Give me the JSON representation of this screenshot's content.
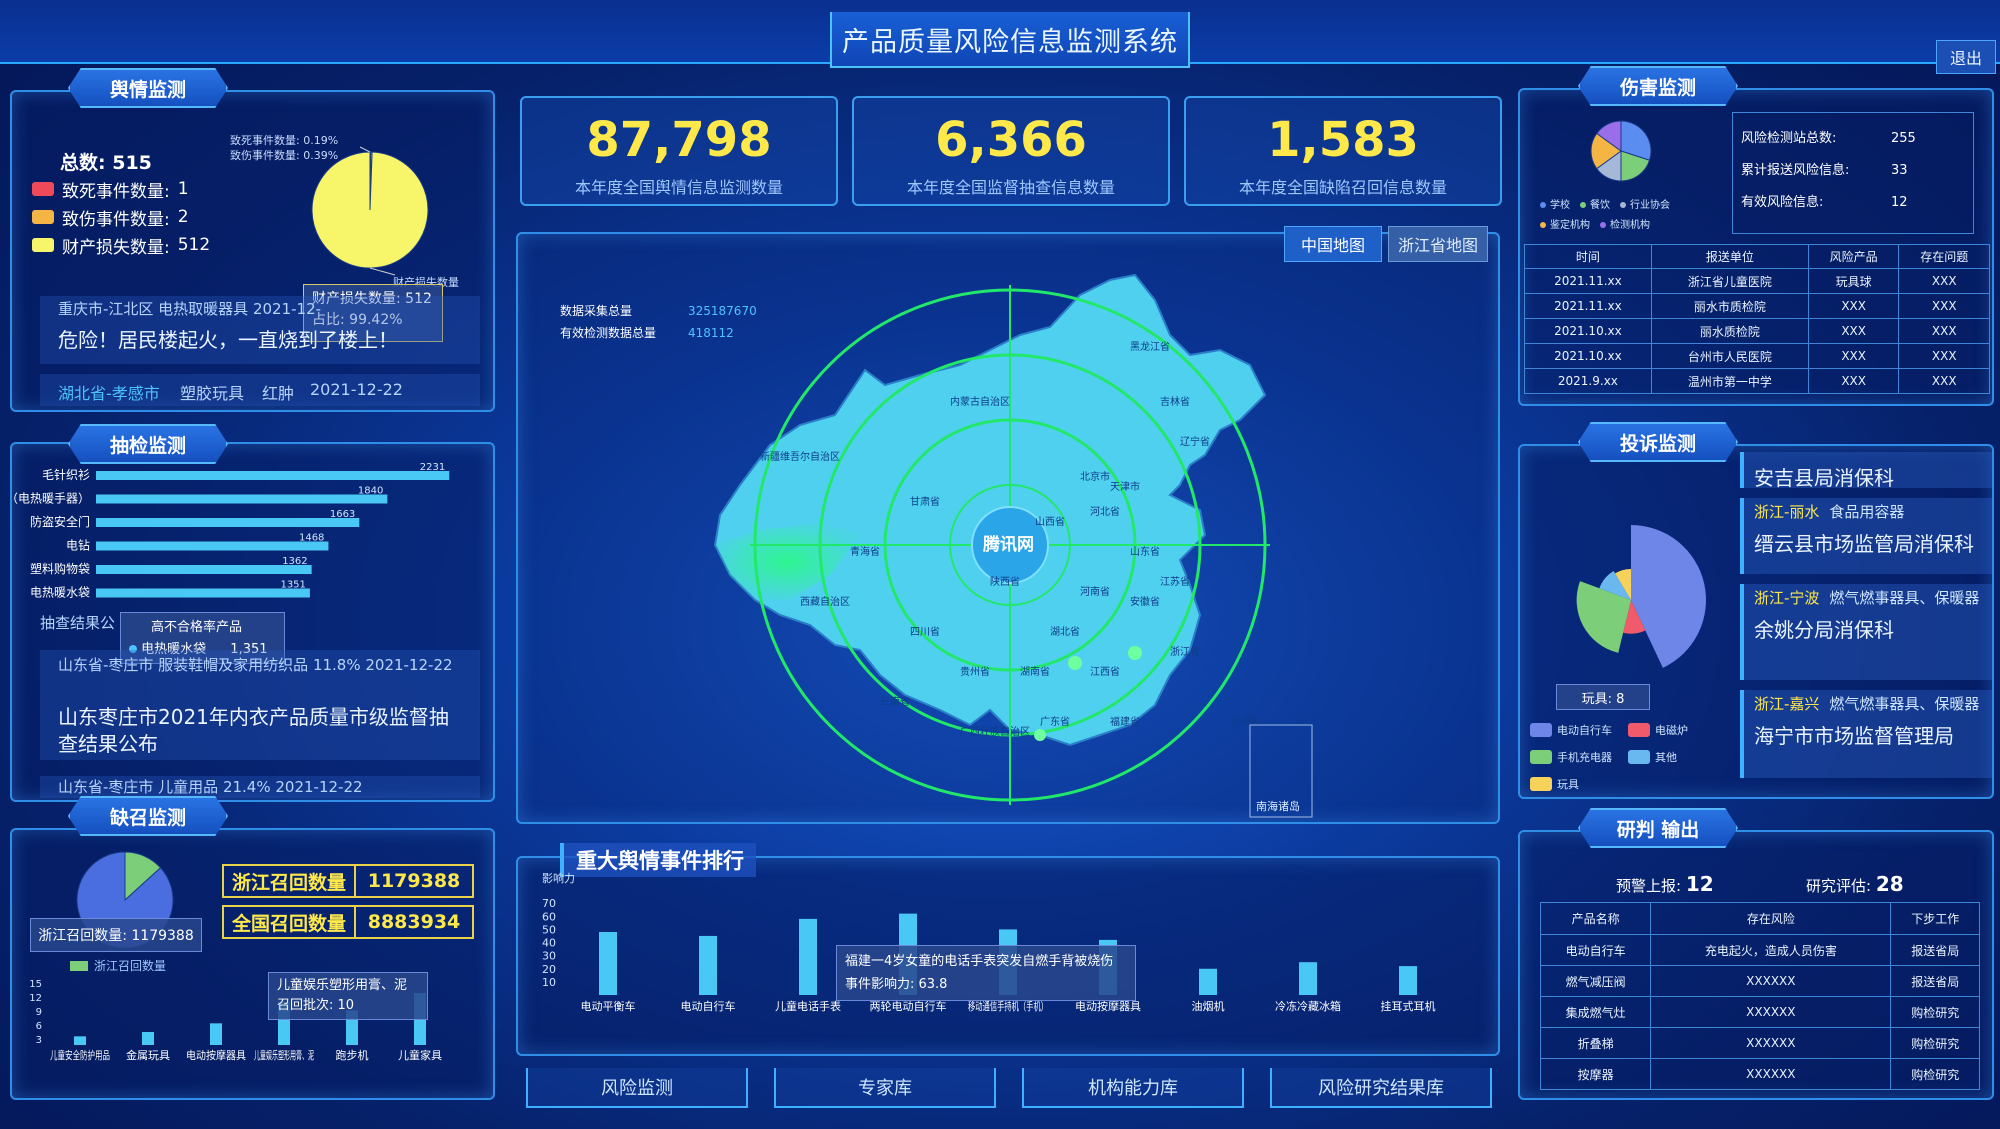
{
  "app": {
    "title": "产品质量风险信息监测系统",
    "logout": "退出"
  },
  "sentiment": {
    "panel_title": "舆情监测",
    "total_label": "总数:",
    "total": "515",
    "legend": [
      {
        "label": "致死事件数量:",
        "value": "1",
        "color": "#f04a5a"
      },
      {
        "label": "致伤事件数量:",
        "value": "2",
        "color": "#f5b545"
      },
      {
        "label": "财产损失数量:",
        "value": "512",
        "color": "#f7f56a"
      }
    ],
    "pie_labels": [
      "致死事件数量: 0.19%",
      "致伤事件数量: 0.39%",
      "财产损失数量"
    ],
    "tooltip_line1": "财产损失数量: 512",
    "tooltip_line2": "占比: 99.42%",
    "news_meta_1": "重庆市-江北区    电热取暖器具    2021-12-",
    "news_headline_1": "危险！居民楼起火，一直烧到了楼上！",
    "news_meta_2_region": "湖北省-孝感市",
    "news_meta_2_cat": "塑胶玩具",
    "news_meta_2_tag": "红肿",
    "news_meta_2_date": "2021-12-22"
  },
  "spotcheck": {
    "panel_title": "抽检监测",
    "overlay_title": "高不合格率产品",
    "overlay_item": "电热暖水袋",
    "overlay_value": "1,351",
    "section_label": "抽查结果公布",
    "news_meta": "山东省-枣庄市    服装鞋帽及家用纺织品    11.8%    2021-12-22",
    "news_headline": "山东枣庄市2021年内衣产品质量市级监督抽查结果公布",
    "news_meta_2": "山东省-枣庄市    儿童用品    21.4%    2021-12-22"
  },
  "recall": {
    "panel_title": "缺召监测",
    "zj_label": "浙江召回数量",
    "zj_value": "1179388",
    "cn_label": "全国召回数量",
    "cn_value": "8883934",
    "pie_tooltip": "浙江召回数量: 1179388",
    "pie_legend": "浙江召回数量",
    "bar_tooltip_line1": "儿童娱乐塑形用膏、泥",
    "bar_tooltip_line2": "召回批次: 10",
    "y_ticks": [
      "15",
      "12",
      "9",
      "6",
      "3"
    ]
  },
  "stats": [
    {
      "value": "87,798",
      "label": "本年度全国舆情信息监测数量"
    },
    {
      "value": "6,366",
      "label": "本年度全国监督抽查信息数量"
    },
    {
      "value": "1,583",
      "label": "本年度全国缺陷召回信息数量"
    }
  ],
  "map": {
    "btn_china": "中国地图",
    "btn_zhejiang": "浙江省地图",
    "data_total_label": "数据采集总量",
    "data_total_value": "325187670",
    "valid_label": "有效检测数据总量",
    "valid_value": "418112",
    "center_label": "腾讯网",
    "south_sea": "南海诸岛",
    "regions": [
      "黑龙江省",
      "吉林省",
      "内蒙古自治区",
      "辽宁省",
      "新疆维吾尔自治区",
      "甘肃省",
      "青海省",
      "西藏自治区",
      "四川省",
      "陕西省",
      "山西省",
      "河北省",
      "北京市",
      "天津市",
      "山东省",
      "河南省",
      "湖北省",
      "安徽省",
      "江苏省",
      "浙江省",
      "湖南省",
      "江西省",
      "福建省",
      "贵州省",
      "云南省",
      "广西壮族自治区",
      "广东省",
      "台湾省"
    ]
  },
  "events": {
    "title": "重大舆情事件排行",
    "ylabel": "影响力",
    "tooltip_line1": "福建一4岁女童的电话手表突发自燃手背被烧伤",
    "tooltip_line2": "事件影响力: 63.8"
  },
  "harm": {
    "panel_title": "伤害监测",
    "stats": [
      {
        "label": "风险检测站总数:",
        "value": "255"
      },
      {
        "label": "累计报送风险信息:",
        "value": "33"
      },
      {
        "label": "有效风险信息:",
        "value": "12"
      }
    ],
    "legend": [
      "学校",
      "餐饮",
      "行业协会",
      "鉴定机构",
      "检测机构"
    ],
    "columns": [
      "时间",
      "报送单位",
      "风险产品",
      "存在问题"
    ],
    "rows": [
      [
        "2021.11.xx",
        "浙江省儿童医院",
        "玩具球",
        "XXX"
      ],
      [
        "2021.11.xx",
        "丽水市质检院",
        "XXX",
        "XXX"
      ],
      [
        "2021.10.xx",
        "丽水质检院",
        "XXX",
        "XXX"
      ],
      [
        "2021.10.xx",
        "台州市人民医院",
        "XXX",
        "XXX"
      ],
      [
        "2021.9.xx",
        "温州市第一中学",
        "XXX",
        "XXX"
      ]
    ]
  },
  "complaint": {
    "panel_title": "投诉监测",
    "items": [
      {
        "region": "",
        "product": "",
        "org": "安吉县局消保科"
      },
      {
        "region": "浙江-丽水",
        "product": "食品用容器",
        "org": "缙云县市场监管局消保科"
      },
      {
        "region": "浙江-宁波",
        "product": "燃气燃事器具、保暖器",
        "org": "余姚分局消保科"
      },
      {
        "region": "浙江-嘉兴",
        "product": "燃气燃事器具、保暖器",
        "org": "海宁市市场监督管理局"
      }
    ],
    "tooltip": "玩具: 8",
    "legend": [
      {
        "label": "电动自行车",
        "color": "#6e86e8"
      },
      {
        "label": "电磁炉",
        "color": "#f05a6a"
      },
      {
        "label": "手机充电器",
        "color": "#7ccf78"
      },
      {
        "label": "其他",
        "color": "#6ab8f0"
      },
      {
        "label": "玩具",
        "color": "#f7d25a"
      }
    ]
  },
  "judgement": {
    "panel_title": "研判 输出",
    "warn_label": "预警上报:",
    "warn_value": "12",
    "eval_label": "研究评估:",
    "eval_value": "28",
    "columns": [
      "产品名称",
      "存在风险",
      "下步工作"
    ],
    "rows": [
      [
        "电动自行车",
        "充电起火，造成人员伤害",
        "报送省局"
      ],
      [
        "燃气减压阀",
        "XXXXXX",
        "报送省局"
      ],
      [
        "集成燃气灶",
        "XXXXXX",
        "购检研究"
      ],
      [
        "折叠梯",
        "XXXXXX",
        "购检研究"
      ],
      [
        "按摩器",
        "XXXXXX",
        "购检研究"
      ]
    ]
  },
  "bottom_nav": [
    "风险监测",
    "专家库",
    "机构能力库",
    "风险研究结果库"
  ],
  "chart_data": [
    {
      "type": "pie",
      "title": "舆情监测",
      "labels": [
        "致死事件数量",
        "致伤事件数量",
        "财产损失数量"
      ],
      "values": [
        1,
        2,
        512
      ],
      "colors": [
        "#f04a5a",
        "#f5b545",
        "#f7f56a"
      ]
    },
    {
      "type": "bar",
      "title": "抽检监测",
      "orientation": "horizontal",
      "categories": [
        "毛针织衫",
        "暖手器（电热暖手器）",
        "防盗安全门",
        "电钻",
        "塑料购物袋",
        "电热暖水袋"
      ],
      "values": [
        2231,
        1840,
        1663,
        1468,
        1362,
        1351
      ]
    },
    {
      "type": "bar",
      "title": "缺召监测",
      "categories": [
        "儿童安全防护用品",
        "金属玩具",
        "电动按摩器具",
        "儿童娱乐塑形用膏、泥",
        "跑步机",
        "儿童家具"
      ],
      "values": [
        2,
        3,
        5,
        10,
        8,
        12
      ],
      "ylim": [
        0,
        15
      ]
    },
    {
      "type": "pie",
      "title": "缺召比例",
      "labels": [
        "浙江召回数量",
        "其他"
      ],
      "values": [
        1179388,
        7704546
      ],
      "colors": [
        "#7ccf78",
        "#4a6ee0"
      ]
    },
    {
      "type": "bar",
      "title": "重大舆情事件排行",
      "ylabel": "影响力",
      "categories": [
        "电动平衡车",
        "电动自行车",
        "儿童电话手表",
        "两轮电动自行车",
        "移动通信手持机（手机）",
        "电动按摩器具",
        "油烟机",
        "冷冻冷藏冰箱",
        "挂耳式耳机"
      ],
      "values": [
        48,
        45,
        58,
        62,
        50,
        42,
        20,
        25,
        22
      ],
      "yticks": [
        10,
        20,
        30,
        40,
        50,
        60,
        70
      ],
      "ylim": [
        0,
        80
      ]
    },
    {
      "type": "pie",
      "title": "伤害监测",
      "labels": [
        "学校",
        "餐饮",
        "行业协会",
        "鉴定机构",
        "检测机构"
      ],
      "values": [
        30,
        20,
        15,
        20,
        15
      ],
      "colors": [
        "#5b8cf0",
        "#7ccf78",
        "#a5b8d8",
        "#f5b545",
        "#9a6ee8"
      ]
    },
    {
      "type": "pie",
      "title": "投诉监测",
      "labels": [
        "电动自行车",
        "电磁炉",
        "手机充电器",
        "其他",
        "玩具"
      ],
      "values": [
        40,
        10,
        25,
        10,
        8
      ],
      "colors": [
        "#6e86e8",
        "#f05a6a",
        "#7ccf78",
        "#6ab8f0",
        "#f7d25a"
      ]
    }
  ]
}
